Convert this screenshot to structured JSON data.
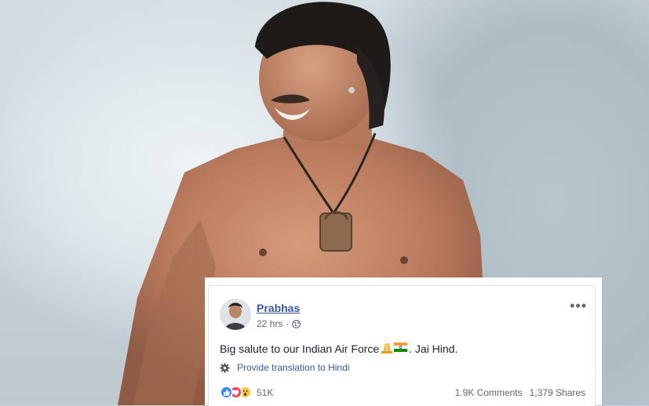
{
  "post": {
    "author": "Prabhas",
    "time": "22 hrs",
    "time_separator": "·",
    "text_before": "Big salute to our Indian Air Force",
    "text_emojis": "🙏🇮🇳",
    "text_after": ". Jai Hind.",
    "translate_label": "Provide translation to Hindi",
    "reaction_count": "51K",
    "comments": "1.9K Comments",
    "shares": "1,379 Shares",
    "more_label": "•••"
  },
  "colors": {
    "link": "#385898",
    "like": "#2d88ff",
    "love": "#f33e58",
    "wow": "#f7c93b"
  },
  "icons": {
    "globe": "globe-icon",
    "gear": "gear-icon",
    "more": "more-options-icon"
  }
}
